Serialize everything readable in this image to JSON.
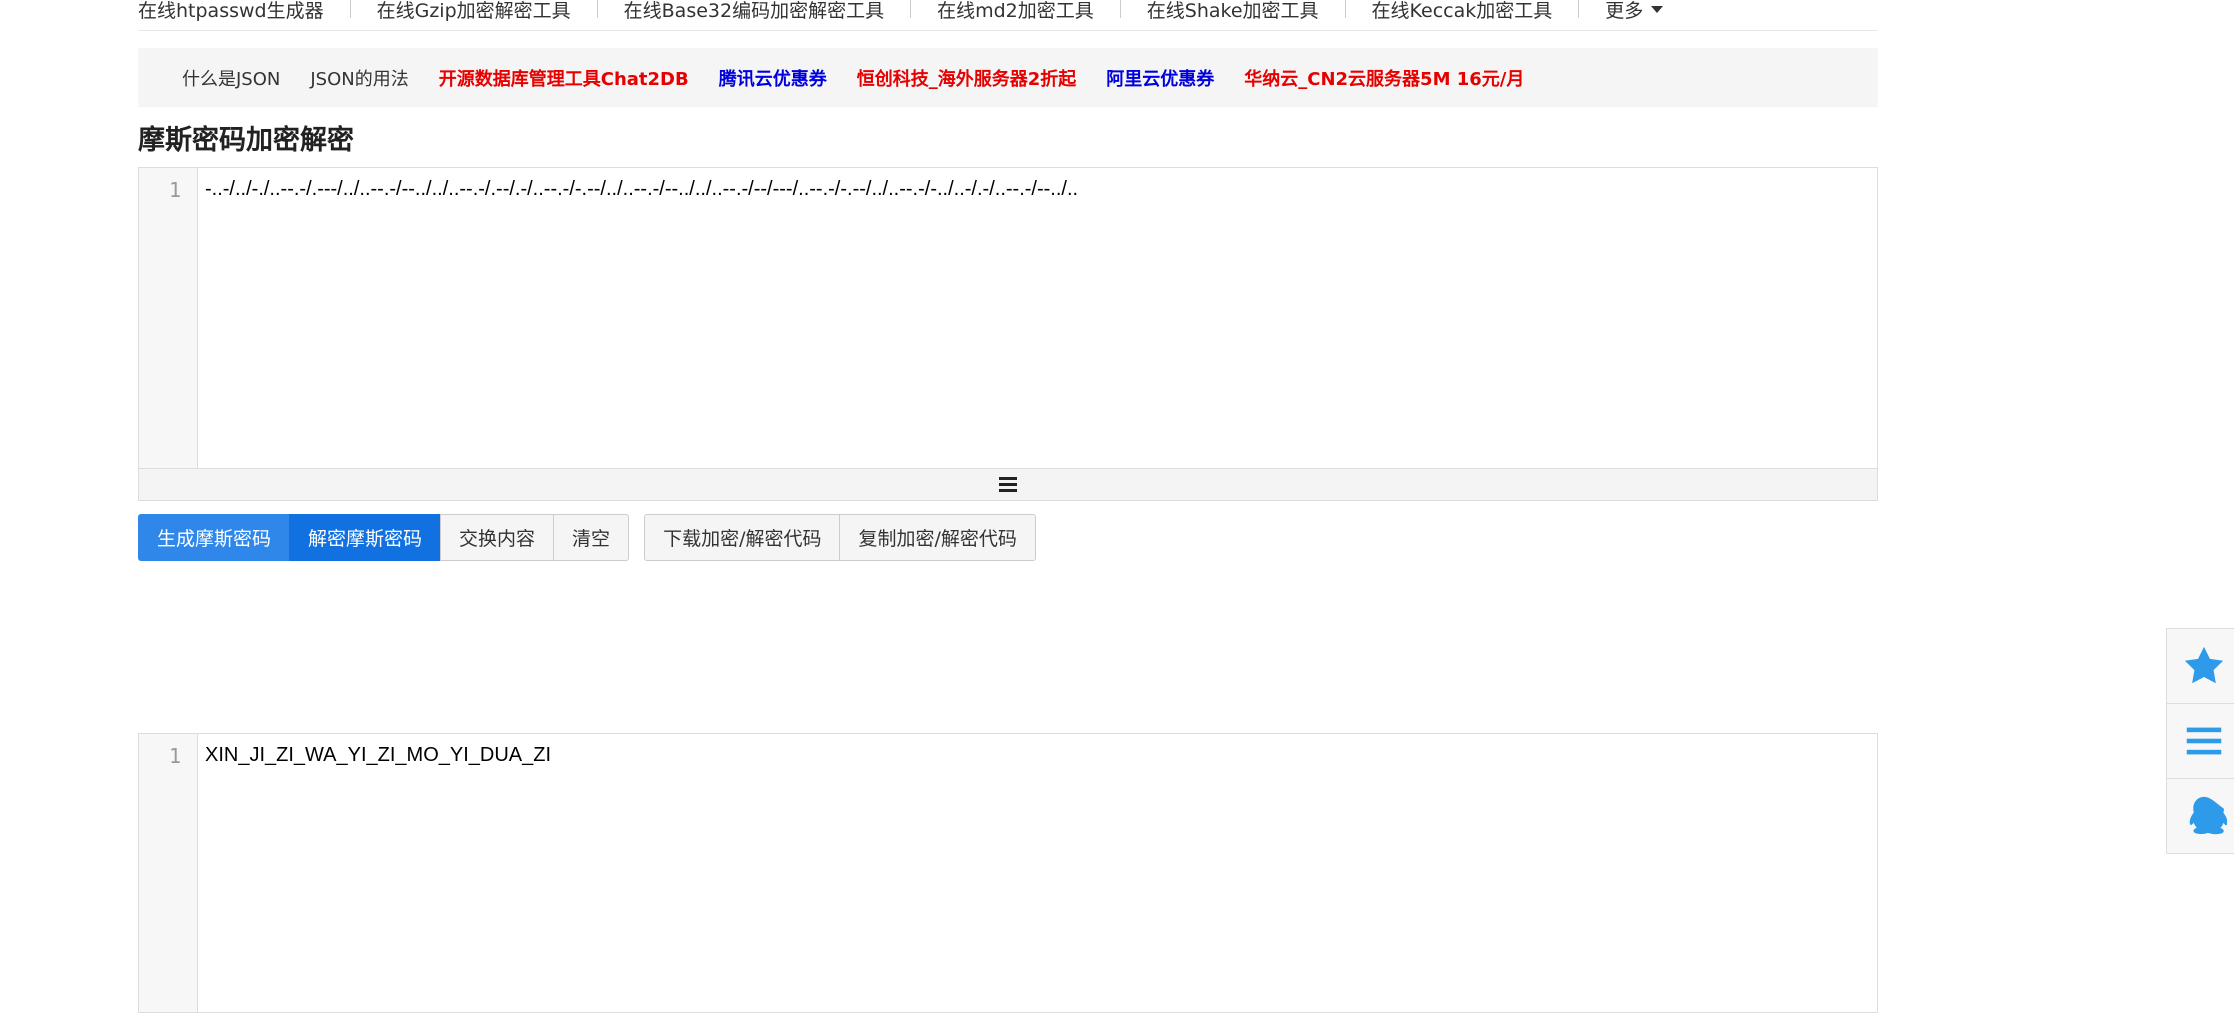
{
  "nav": {
    "items": [
      "在线htpasswd生成器",
      "在线Gzip加密解密工具",
      "在线Base32编码加密解密工具",
      "在线md2加密工具",
      "在线Shake加密工具",
      "在线Keccak加密工具"
    ],
    "more_label": "更多"
  },
  "links": [
    {
      "text": "什么是JSON",
      "style": "plain"
    },
    {
      "text": "JSON的用法",
      "style": "plain"
    },
    {
      "text": "开源数据库管理工具Chat2DB",
      "style": "red"
    },
    {
      "text": "腾讯云优惠券",
      "style": "blue"
    },
    {
      "text": "恒创科技_海外服务器2折起",
      "style": "red"
    },
    {
      "text": "阿里云优惠券",
      "style": "blue"
    },
    {
      "text": "华纳云_CN2云服务器5M 16元/月",
      "style": "red"
    }
  ],
  "page": {
    "title": "摩斯密码加密解密"
  },
  "input_editor": {
    "line_number": "1",
    "content": "-..-/../-./..--.-/.---/../..--.-/--../../..--.-/.--/.-/..--.-/-.--/../..--.-/--../../..--.-/--/---/..--.-/-.--/../..--.-/-../..-/.-/..--.-/--../.."
  },
  "buttons": {
    "encode": "生成摩斯密码",
    "decode": "解密摩斯密码",
    "swap": "交换内容",
    "clear": "清空",
    "download": "下载加密/解密代码",
    "copy": "复制加密/解密代码"
  },
  "output_editor": {
    "line_number": "1",
    "content": "XIN_JI_ZI_WA_YI_ZI_MO_YI_DUA_ZI"
  },
  "side_toolbar": {
    "icons": [
      "star-icon",
      "menu-icon",
      "qq-icon"
    ],
    "accent_color": "#2e9bea"
  },
  "colors": {
    "primary_button": "#2f87ea",
    "active_button": "#1171e0",
    "link_red": "#e60000",
    "link_blue": "#0000dd"
  }
}
